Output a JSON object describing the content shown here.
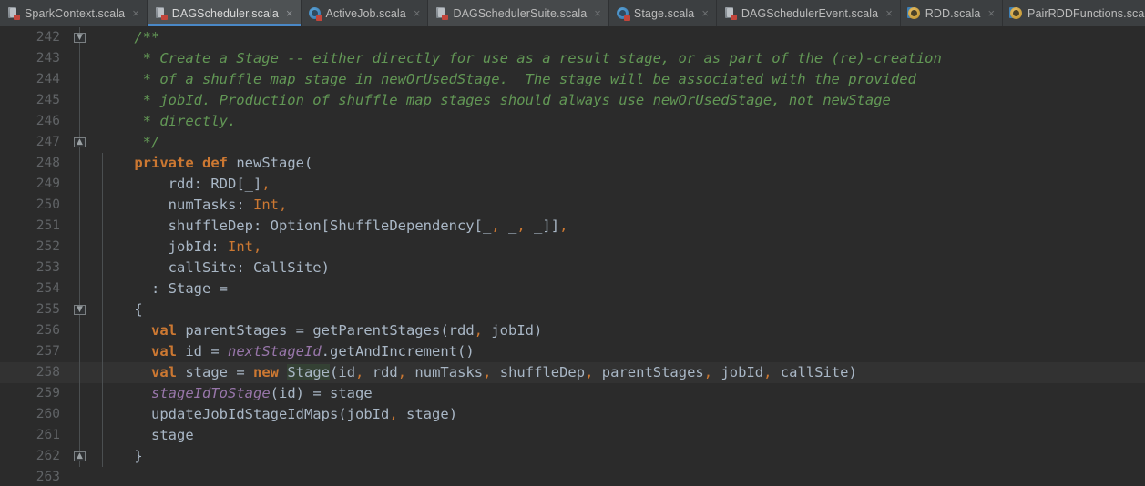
{
  "window": {
    "theme_bg": "#2b2b2b",
    "tabbar_bg": "#3c3f41",
    "active_tab_underline": "#4a88c7",
    "current_line_bg": "#323232"
  },
  "tabs": [
    {
      "label": "SparkContext.scala",
      "icon": "scala-file-icon",
      "active": false,
      "lit": false,
      "close": "×"
    },
    {
      "label": "DAGScheduler.scala",
      "icon": "scala-file-icon",
      "active": true,
      "lit": false,
      "close": "×"
    },
    {
      "label": "ActiveJob.scala",
      "icon": "scala-class-icon",
      "active": false,
      "lit": false,
      "close": "×"
    },
    {
      "label": "DAGSchedulerSuite.scala",
      "icon": "scala-file-icon",
      "active": false,
      "lit": true,
      "close": "×"
    },
    {
      "label": "Stage.scala",
      "icon": "scala-class-icon",
      "active": false,
      "lit": false,
      "close": "×"
    },
    {
      "label": "DAGSchedulerEvent.scala",
      "icon": "scala-file-icon",
      "active": false,
      "lit": false,
      "close": "×"
    },
    {
      "label": "RDD.scala",
      "icon": "scala-object-icon",
      "active": false,
      "lit": false,
      "close": "×"
    },
    {
      "label": "PairRDDFunctions.scala",
      "icon": "scala-object-icon",
      "active": false,
      "lit": false,
      "close": "×"
    }
  ],
  "editor": {
    "language": "scala",
    "first_line": 242,
    "last_line": 263,
    "current_line": 258,
    "lines": [
      {
        "n": "242",
        "fold": "▼",
        "text": "    /**"
      },
      {
        "n": "243",
        "fold": "",
        "text": "     * Create a Stage -- either directly for use as a result stage, or as part of the (re)-creation"
      },
      {
        "n": "244",
        "fold": "",
        "text": "     * of a shuffle map stage in newOrUsedStage.  The stage will be associated with the provided"
      },
      {
        "n": "245",
        "fold": "",
        "text": "     * jobId. Production of shuffle map stages should always use newOrUsedStage, not newStage"
      },
      {
        "n": "246",
        "fold": "",
        "text": "     * directly."
      },
      {
        "n": "247",
        "fold": "▲",
        "text": "     */"
      },
      {
        "n": "248",
        "fold": "",
        "text": "    private def newStage("
      },
      {
        "n": "249",
        "fold": "",
        "text": "        rdd: RDD[_],"
      },
      {
        "n": "250",
        "fold": "",
        "text": "        numTasks: Int,"
      },
      {
        "n": "251",
        "fold": "",
        "text": "        shuffleDep: Option[ShuffleDependency[_, _, _]],"
      },
      {
        "n": "252",
        "fold": "",
        "text": "        jobId: Int,"
      },
      {
        "n": "253",
        "fold": "",
        "text": "        callSite: CallSite)"
      },
      {
        "n": "254",
        "fold": "",
        "text": "      : Stage ="
      },
      {
        "n": "255",
        "fold": "▼",
        "text": "    {"
      },
      {
        "n": "256",
        "fold": "",
        "text": "      val parentStages = getParentStages(rdd, jobId)"
      },
      {
        "n": "257",
        "fold": "",
        "text": "      val id = nextStageId.getAndIncrement()"
      },
      {
        "n": "258",
        "fold": "",
        "text": "      val stage = new Stage(id, rdd, numTasks, shuffleDep, parentStages, jobId, callSite)"
      },
      {
        "n": "259",
        "fold": "",
        "text": "      stageIdToStage(id) = stage"
      },
      {
        "n": "260",
        "fold": "",
        "text": "      updateJobIdStageIdMaps(jobId, stage)"
      },
      {
        "n": "261",
        "fold": "",
        "text": "      stage"
      },
      {
        "n": "262",
        "fold": "▲",
        "text": "    }"
      },
      {
        "n": "263",
        "fold": "",
        "text": ""
      }
    ]
  }
}
